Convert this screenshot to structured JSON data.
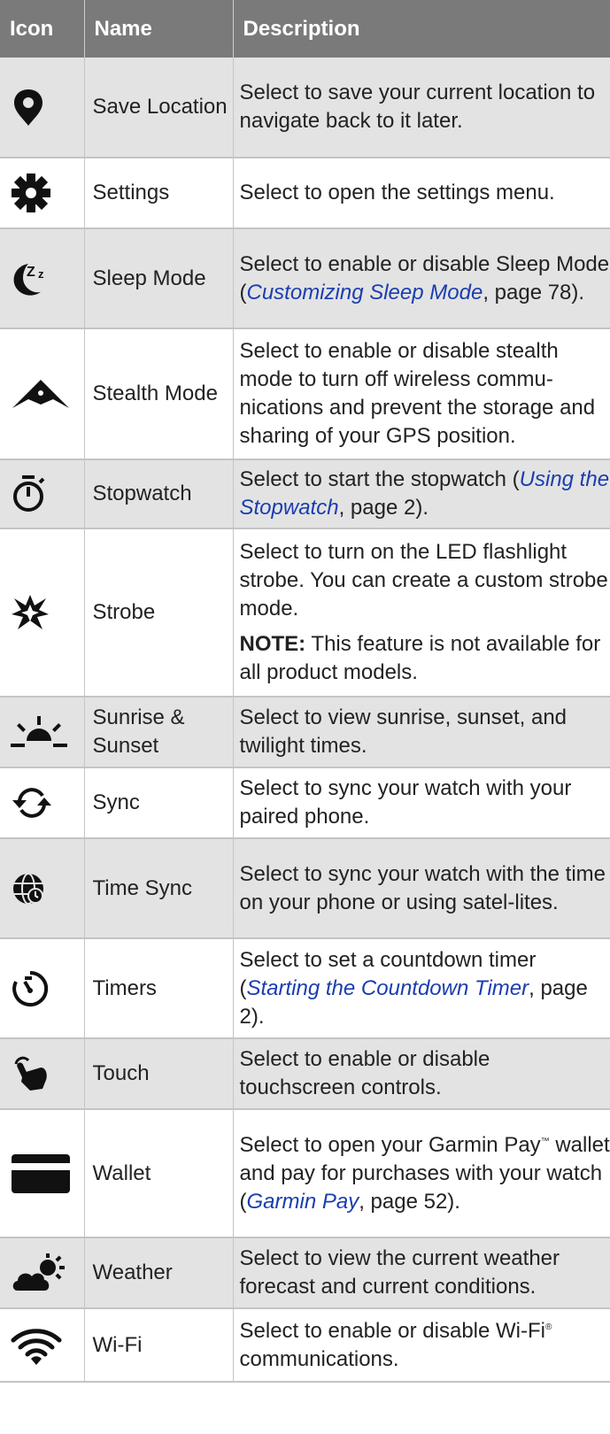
{
  "headers": {
    "icon": "Icon",
    "name": "Name",
    "description": "Description"
  },
  "rows": [
    {
      "name": "Save Location",
      "icon": "map-pin-icon",
      "desc": "Select to save your current location to navigate back to it later."
    },
    {
      "name": "Settings",
      "icon": "gear-icon",
      "desc": "Select to open the settings menu."
    },
    {
      "name": "Sleep Mode",
      "icon": "sleep-moon-icon",
      "desc_pre": "Select to enable or disable Sleep Mode (",
      "desc_link": "Customizing Sleep Mode",
      "desc_post": ", page 78)."
    },
    {
      "name": "Stealth Mode",
      "icon": "stealth-wing-icon",
      "desc": "Select to enable or disable stealth mode to turn off wireless commu-nications and prevent the storage and sharing of your GPS position."
    },
    {
      "name": "Stopwatch",
      "icon": "stopwatch-icon",
      "desc_pre": "Select to start the stopwatch (",
      "desc_link": "Using the Stopwatch",
      "desc_post": ", page 2)."
    },
    {
      "name": "Strobe",
      "icon": "strobe-burst-icon",
      "desc": "Select to turn on the LED flashlight strobe. You can create a custom strobe mode.",
      "note_label": "NOTE:",
      "note_text": " This feature is not available for all product models."
    },
    {
      "name": "Sunrise & Sunset",
      "icon": "sunrise-icon",
      "desc": "Select to view sunrise, sunset, and twilight times."
    },
    {
      "name": "Sync",
      "icon": "sync-arrows-icon",
      "desc": "Select to sync your watch with your paired phone."
    },
    {
      "name": "Time Sync",
      "icon": "globe-clock-icon",
      "desc": "Select to sync your watch with the time on your phone or using satel-lites."
    },
    {
      "name": "Timers",
      "icon": "timer-icon",
      "desc_pre": "Select to set a countdown timer (",
      "desc_link": "Starting the Countdown Timer",
      "desc_post": ", page 2)."
    },
    {
      "name": "Touch",
      "icon": "touch-hand-icon",
      "desc": "Select to enable or disable touchscreen controls."
    },
    {
      "name": "Wallet",
      "icon": "wallet-card-icon",
      "desc_a": "Select to open your Garmin Pay",
      "desc_tm": "™",
      "desc_b": " wallet and pay for purchases with your watch (",
      "desc_link": "Garmin Pay",
      "desc_post": ", page 52)."
    },
    {
      "name": "Weather",
      "icon": "weather-cloud-sun-icon",
      "desc": "Select to view the current weather forecast and current conditions."
    },
    {
      "name": "Wi-Fi",
      "icon": "wifi-icon",
      "desc_a": "Select to enable or disable Wi-Fi",
      "desc_tm": "®",
      "desc_b": " communications."
    }
  ]
}
